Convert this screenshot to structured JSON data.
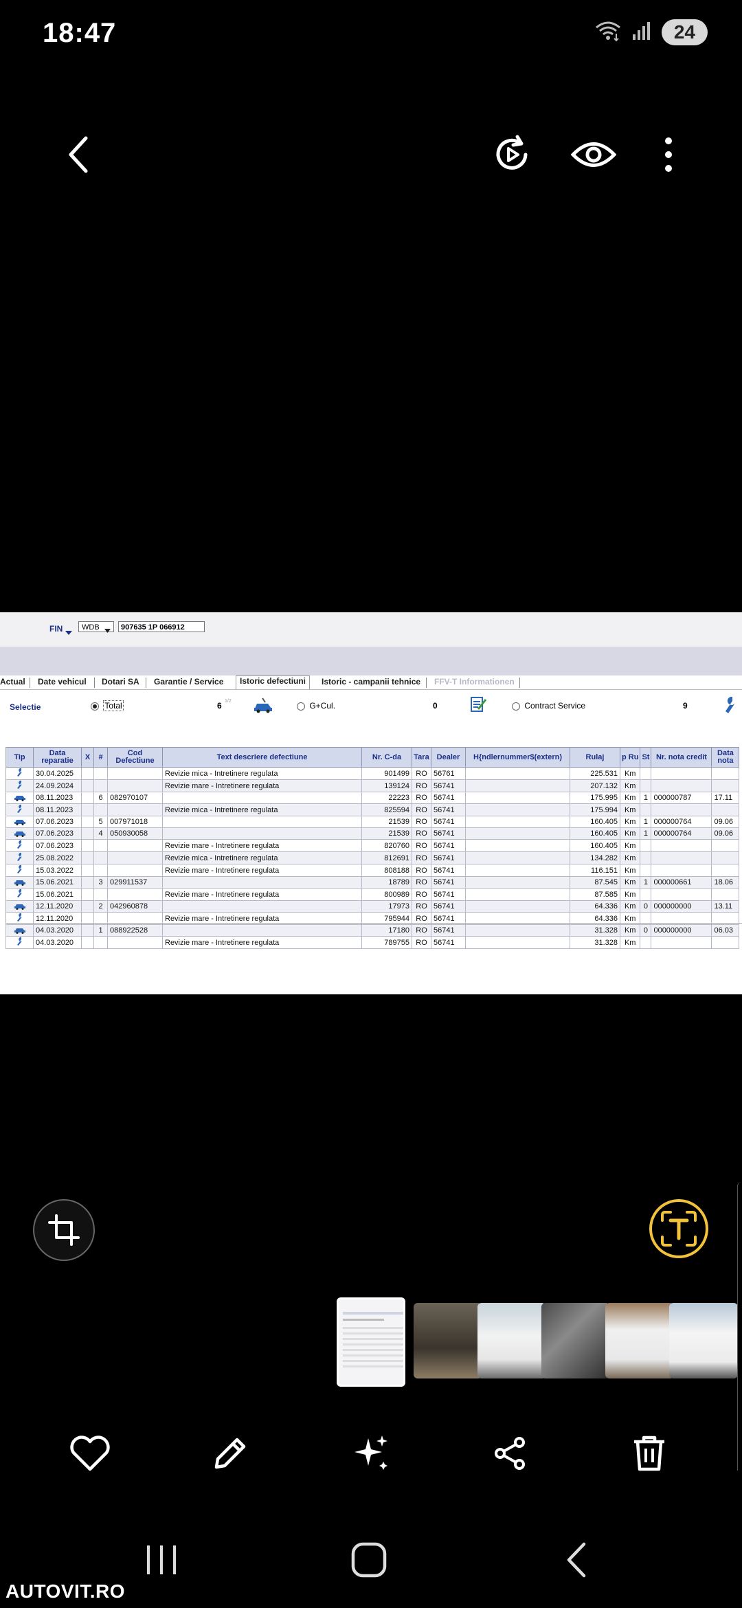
{
  "status_bar": {
    "time": "18:47",
    "battery": "24"
  },
  "icons": {
    "back": "chevron-left-icon",
    "remaster": "play-refresh-icon",
    "view": "eye-icon",
    "more": "kebab-menu-icon",
    "crop": "crop-rotate-icon",
    "text_extract": "text-extract-icon",
    "like": "heart-icon",
    "edit": "pencil-icon",
    "ai": "sparkles-icon",
    "share": "share-icon",
    "delete": "trash-icon",
    "nav_recents": "recents-icon",
    "nav_home": "home-icon",
    "nav_back": "back-icon"
  },
  "colors": {
    "accent_text_button": "#f2c23a",
    "grid_header": "#d3d9ec",
    "link_blue": "#1b2f8a"
  },
  "photo": {
    "header": {
      "fin_label": "FIN",
      "fin_prefix": "WDB",
      "vin": "907635 1P 066912"
    },
    "tabs": [
      "Actual",
      "Date vehicul",
      "Dotari SA",
      "Garantie / Service",
      "Istoric defectiuni",
      "Istoric - campanii tehnice",
      "FFV-T Informationen"
    ],
    "active_tab": "Istoric defectiuni",
    "selection": {
      "label": "Selectie",
      "total_label": "Total",
      "total_count": "6",
      "gcul_label": "G+Cul.",
      "gcul_count": "0",
      "contract_label": "Contract Service",
      "contract_count": "9"
    },
    "table": {
      "headers": [
        "Tip",
        "Data reparatie",
        "X",
        "#",
        "Cod Defectiune",
        "Text descriere defectiune",
        "Nr. C-da",
        "Tara",
        "Dealer",
        "H{ndlernummer$(extern)",
        "Rulaj",
        "p Ru",
        "St",
        "Nr. nota credit",
        "Data nota"
      ],
      "rows": [
        {
          "tip": "wrench",
          "date": "30.04.2025",
          "x": "",
          "nr": "",
          "cod": "",
          "text": "Revizie mica - Intretinere regulata",
          "cda": "901499",
          "tara": "RO",
          "dealer": "56761",
          "ext": "",
          "rulaj": "225.531",
          "unit": "Km",
          "st": "",
          "nota": "",
          "data_nota": ""
        },
        {
          "tip": "wrench",
          "date": "24.09.2024",
          "x": "",
          "nr": "",
          "cod": "",
          "text": "Revizie mare - Intretinere regulata",
          "cda": "139124",
          "tara": "RO",
          "dealer": "56741",
          "ext": "",
          "rulaj": "207.132",
          "unit": "Km",
          "st": "",
          "nota": "",
          "data_nota": ""
        },
        {
          "tip": "car",
          "date": "08.11.2023",
          "x": "",
          "nr": "6",
          "cod": "082970107",
          "text": "",
          "cda": "22223",
          "tara": "RO",
          "dealer": "56741",
          "ext": "",
          "rulaj": "175.995",
          "unit": "Km",
          "st": "1",
          "nota": "000000787",
          "data_nota": "17.11"
        },
        {
          "tip": "wrench",
          "date": "08.11.2023",
          "x": "",
          "nr": "",
          "cod": "",
          "text": "Revizie mica - Intretinere regulata",
          "cda": "825594",
          "tara": "RO",
          "dealer": "56741",
          "ext": "",
          "rulaj": "175.994",
          "unit": "Km",
          "st": "",
          "nota": "",
          "data_nota": ""
        },
        {
          "tip": "car",
          "date": "07.06.2023",
          "x": "",
          "nr": "5",
          "cod": "007971018",
          "text": "",
          "cda": "21539",
          "tara": "RO",
          "dealer": "56741",
          "ext": "",
          "rulaj": "160.405",
          "unit": "Km",
          "st": "1",
          "nota": "000000764",
          "data_nota": "09.06"
        },
        {
          "tip": "car",
          "date": "07.06.2023",
          "x": "",
          "nr": "4",
          "cod": "050930058",
          "text": "",
          "cda": "21539",
          "tara": "RO",
          "dealer": "56741",
          "ext": "",
          "rulaj": "160.405",
          "unit": "Km",
          "st": "1",
          "nota": "000000764",
          "data_nota": "09.06"
        },
        {
          "tip": "wrench",
          "date": "07.06.2023",
          "x": "",
          "nr": "",
          "cod": "",
          "text": "Revizie mare - Intretinere regulata",
          "cda": "820760",
          "tara": "RO",
          "dealer": "56741",
          "ext": "",
          "rulaj": "160.405",
          "unit": "Km",
          "st": "",
          "nota": "",
          "data_nota": ""
        },
        {
          "tip": "wrench",
          "date": "25.08.2022",
          "x": "",
          "nr": "",
          "cod": "",
          "text": "Revizie mica - Intretinere regulata",
          "cda": "812691",
          "tara": "RO",
          "dealer": "56741",
          "ext": "",
          "rulaj": "134.282",
          "unit": "Km",
          "st": "",
          "nota": "",
          "data_nota": ""
        },
        {
          "tip": "wrench",
          "date": "15.03.2022",
          "x": "",
          "nr": "",
          "cod": "",
          "text": "Revizie mare - Intretinere regulata",
          "cda": "808188",
          "tara": "RO",
          "dealer": "56741",
          "ext": "",
          "rulaj": "116.151",
          "unit": "Km",
          "st": "",
          "nota": "",
          "data_nota": ""
        },
        {
          "tip": "car",
          "date": "15.06.2021",
          "x": "",
          "nr": "3",
          "cod": "029911537",
          "text": "",
          "cda": "18789",
          "tara": "RO",
          "dealer": "56741",
          "ext": "",
          "rulaj": "87.545",
          "unit": "Km",
          "st": "1",
          "nota": "000000661",
          "data_nota": "18.06"
        },
        {
          "tip": "wrench",
          "date": "15.06.2021",
          "x": "",
          "nr": "",
          "cod": "",
          "text": "Revizie mare - Intretinere regulata",
          "cda": "800989",
          "tara": "RO",
          "dealer": "56741",
          "ext": "",
          "rulaj": "87.585",
          "unit": "Km",
          "st": "",
          "nota": "",
          "data_nota": ""
        },
        {
          "tip": "car",
          "date": "12.11.2020",
          "x": "",
          "nr": "2",
          "cod": "042960878",
          "text": "",
          "cda": "17973",
          "tara": "RO",
          "dealer": "56741",
          "ext": "",
          "rulaj": "64.336",
          "unit": "Km",
          "st": "0",
          "nota": "000000000",
          "data_nota": "13.11"
        },
        {
          "tip": "wrench",
          "date": "12.11.2020",
          "x": "",
          "nr": "",
          "cod": "",
          "text": "Revizie mare - Intretinere regulata",
          "cda": "795944",
          "tara": "RO",
          "dealer": "56741",
          "ext": "",
          "rulaj": "64.336",
          "unit": "Km",
          "st": "",
          "nota": "",
          "data_nota": ""
        },
        {
          "tip": "car",
          "date": "04.03.2020",
          "x": "",
          "nr": "1",
          "cod": "088922528",
          "text": "",
          "cda": "17180",
          "tara": "RO",
          "dealer": "56741",
          "ext": "",
          "rulaj": "31.328",
          "unit": "Km",
          "st": "0",
          "nota": "000000000",
          "data_nota": "06.03"
        },
        {
          "tip": "wrench",
          "date": "04.03.2020",
          "x": "",
          "nr": "",
          "cod": "",
          "text": "Revizie mare - Intretinere regulata",
          "cda": "789755",
          "tara": "RO",
          "dealer": "56741",
          "ext": "",
          "rulaj": "31.328",
          "unit": "Km",
          "st": "",
          "nota": "",
          "data_nota": ""
        }
      ]
    }
  },
  "filmstrip": {
    "count": 6
  },
  "watermark": "AUTOVIT.RO"
}
